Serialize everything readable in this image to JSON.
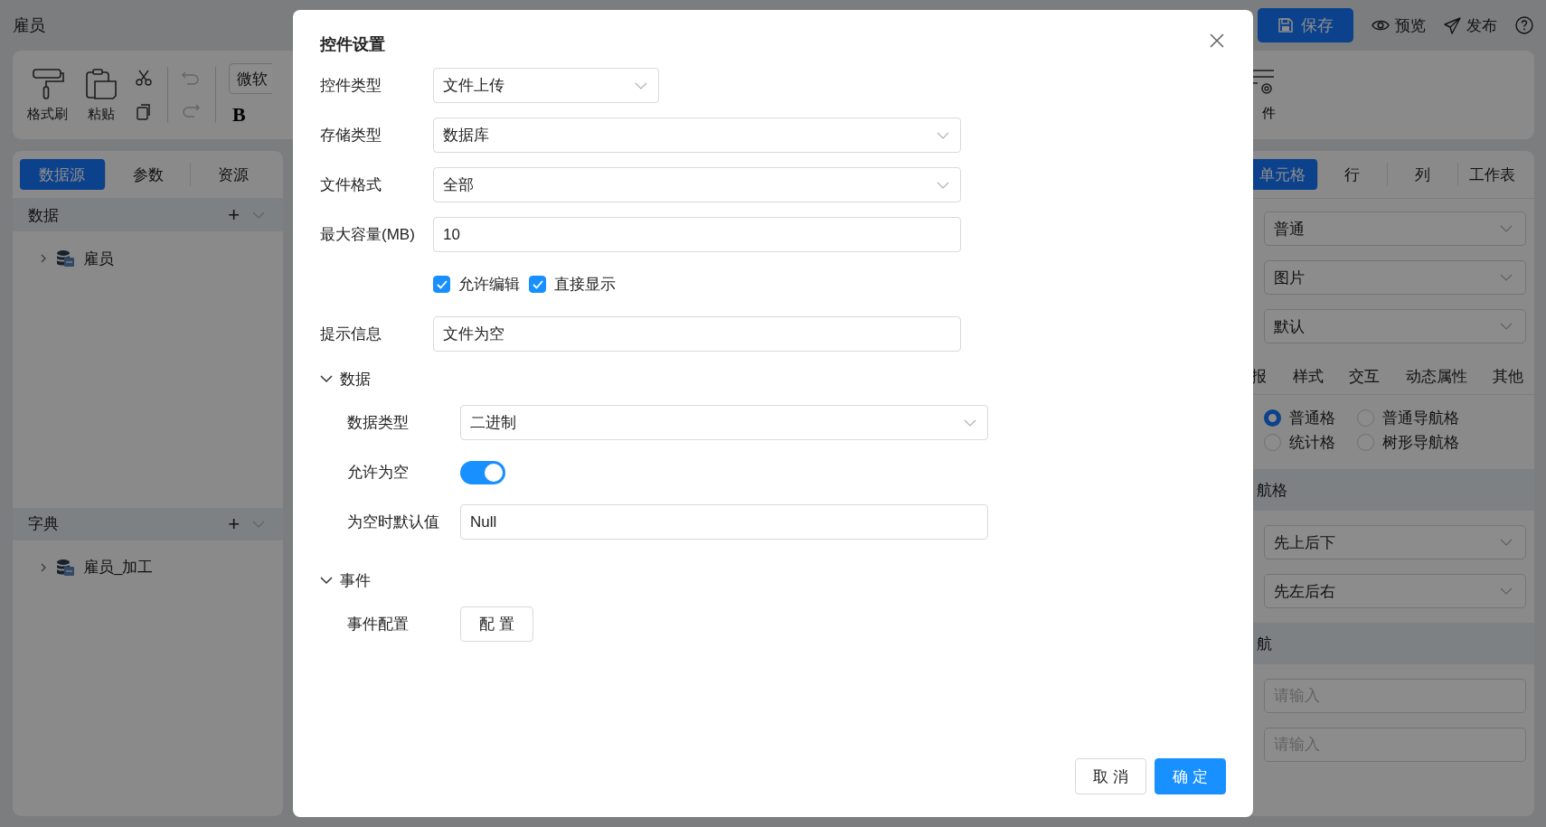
{
  "app": {
    "title": "雇员",
    "actions": [
      {
        "kind": "save",
        "label": "保存"
      },
      {
        "kind": "preview",
        "label": "预览"
      },
      {
        "kind": "publish",
        "label": "发布"
      },
      {
        "kind": "help"
      }
    ]
  },
  "toolbar": {
    "tools": [
      {
        "kind": "brush",
        "label": "格式刷"
      },
      {
        "kind": "paste",
        "label": "粘贴"
      }
    ],
    "edits": [
      {
        "kind": "cut",
        "disabled": false
      },
      {
        "kind": "copy",
        "disabled": false
      }
    ],
    "history": [
      {
        "kind": "undo",
        "disabled": true
      },
      {
        "kind": "redo",
        "disabled": true
      }
    ],
    "font": "微软",
    "bold": "B",
    "right": {
      "kind": "event",
      "label": "件"
    }
  },
  "left_panel": {
    "tabs": [
      {
        "label": "数据源",
        "selected": true
      },
      {
        "label": "参数",
        "selected": false
      },
      {
        "label": "资源",
        "selected": false
      }
    ],
    "sections": [
      {
        "title": "数据",
        "add": "+",
        "items": [
          {
            "label": "雇员",
            "expanded": false
          }
        ]
      },
      {
        "title": "字典",
        "add": "+",
        "items": [
          {
            "label": "雇员_加工",
            "expanded": false
          }
        ]
      }
    ]
  },
  "right_panel": {
    "tabs": [
      {
        "label": "单元格",
        "selected": true
      },
      {
        "label": "行",
        "selected": false
      },
      {
        "label": "列",
        "selected": false
      },
      {
        "label": "工作表",
        "selected": false
      }
    ],
    "selects": [
      "普通",
      "图片",
      "默认"
    ],
    "subtabs": [
      "报",
      "样式",
      "交互",
      "动态属性",
      "其他"
    ],
    "radios": [
      {
        "label": "普通格",
        "selected": true
      },
      {
        "label": "普通导航格",
        "selected": false
      },
      {
        "label": "统计格",
        "selected": false
      },
      {
        "label": "树形导航格",
        "selected": false
      }
    ],
    "sections": [
      {
        "title": "航格",
        "fields": [
          {
            "kind": "select",
            "value": "先上后下"
          },
          {
            "kind": "select",
            "value": "先左后右"
          }
        ]
      },
      {
        "title": "航",
        "fields": [
          {
            "kind": "input",
            "placeholder": "请输入"
          },
          {
            "kind": "input",
            "placeholder": "请输入"
          }
        ]
      }
    ]
  },
  "dialog": {
    "title": "控件设置",
    "fields": [
      {
        "kind": "select",
        "label": "控件类型",
        "value": "文件上传"
      },
      {
        "kind": "select",
        "label": "存储类型",
        "value": "数据库"
      },
      {
        "kind": "select",
        "label": "文件格式",
        "value": "全部"
      },
      {
        "kind": "input",
        "label": "最大容量(MB)",
        "value": "10"
      },
      {
        "kind": "checks",
        "options": [
          {
            "label": "允许编辑",
            "checked": true
          },
          {
            "label": "直接显示",
            "checked": true
          }
        ]
      },
      {
        "kind": "input",
        "label": "提示信息",
        "value": "文件为空"
      }
    ],
    "sections": [
      {
        "title": "数据",
        "expanded": true,
        "fields": [
          {
            "kind": "select",
            "label": "数据类型",
            "value": "二进制"
          },
          {
            "kind": "switch",
            "label": "允许为空",
            "on": true
          },
          {
            "kind": "input",
            "label": "为空时默认值",
            "value": "Null"
          }
        ]
      },
      {
        "title": "事件",
        "expanded": true,
        "fields": [
          {
            "kind": "button",
            "label": "事件配置",
            "button": "配 置"
          }
        ]
      }
    ],
    "buttons": [
      {
        "label": "取 消",
        "primary": false
      },
      {
        "label": "确 定",
        "primary": true
      }
    ]
  }
}
